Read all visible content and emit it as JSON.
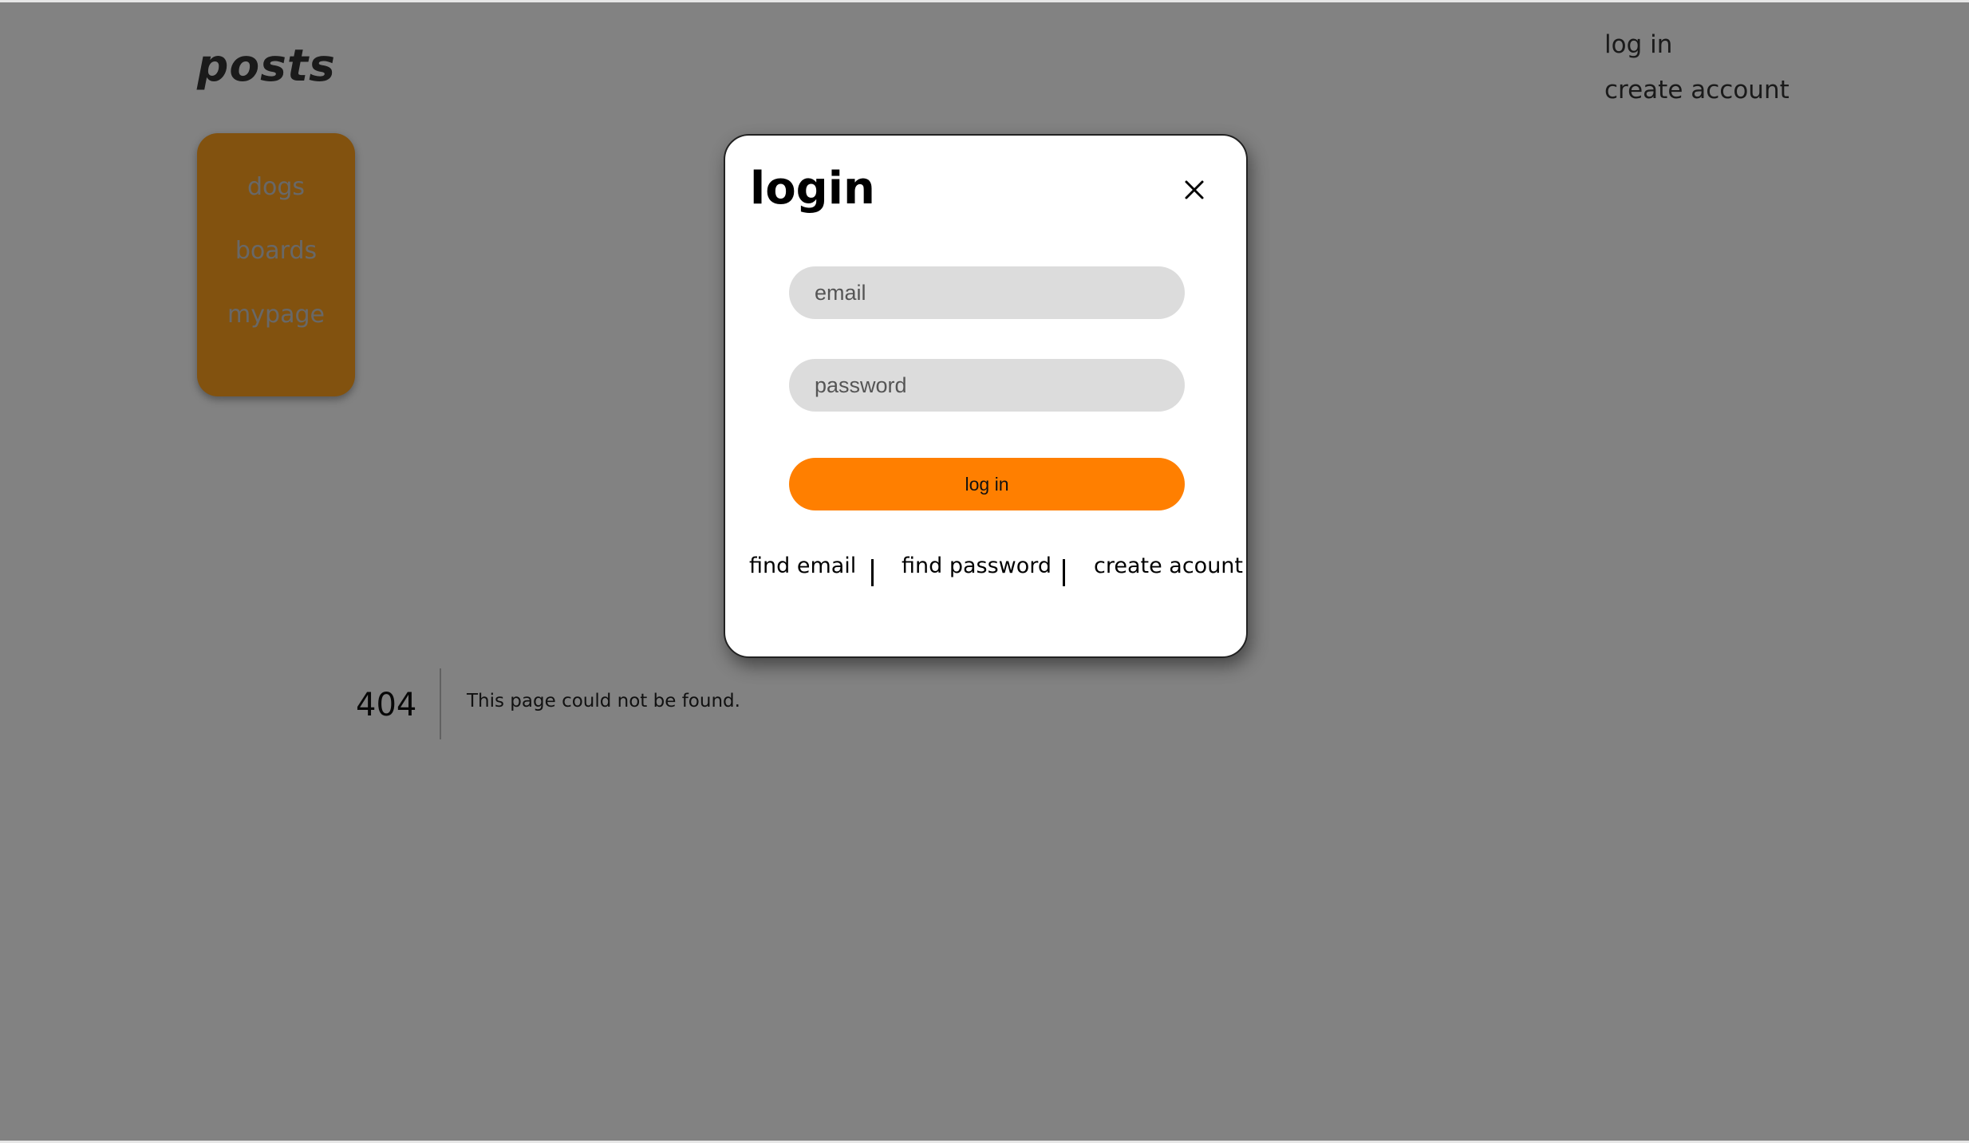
{
  "page": {
    "site_title": "posts",
    "sidebar": {
      "items": [
        {
          "label": "dogs"
        },
        {
          "label": "boards"
        },
        {
          "label": "mypage"
        }
      ]
    },
    "top_nav": {
      "login_label": "log in",
      "create_account_label": "create account"
    },
    "error": {
      "code": "404",
      "message": "This page could not be found."
    }
  },
  "modal": {
    "title": "login",
    "close_icon": "close-icon",
    "email": {
      "placeholder": "email",
      "value": ""
    },
    "password": {
      "placeholder": "password",
      "value": ""
    },
    "submit_label": "log in",
    "links": {
      "find_email": "find email",
      "find_password": "find password",
      "create_account": "create acount"
    }
  },
  "colors": {
    "accent": "#ff7f00",
    "sidebar_bg": "#ffa11f",
    "overlay": "rgba(0,0,0,0.49)",
    "input_bg": "#dcdcdc"
  }
}
